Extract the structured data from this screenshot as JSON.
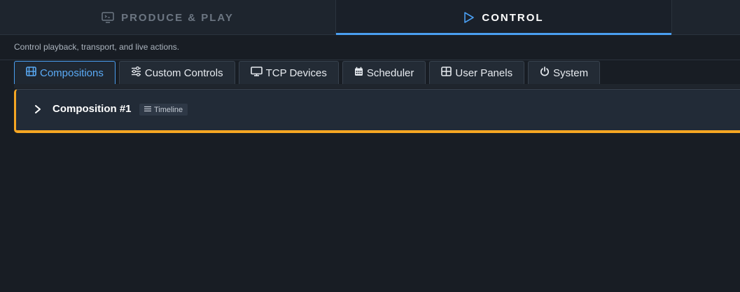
{
  "top_nav": {
    "produce_label": "PRODUCE & PLAY",
    "control_label": "CONTROL",
    "produce_icon": "monitor-code-icon",
    "control_icon": "play-triangle-icon",
    "active": "CONTROL"
  },
  "subtitle": "Control playback, transport, and live actions.",
  "tabs": [
    {
      "label": "Compositions",
      "icon": "film-icon",
      "active": true
    },
    {
      "label": "Custom Controls",
      "icon": "sliders-icon",
      "active": false
    },
    {
      "label": "TCP Devices",
      "icon": "monitor-icon",
      "active": false
    },
    {
      "label": "Scheduler",
      "icon": "calendar-icon",
      "active": false
    },
    {
      "label": "User Panels",
      "icon": "grid-icon",
      "active": false
    },
    {
      "label": "System",
      "icon": "power-icon",
      "active": false
    }
  ],
  "composition": {
    "name": "Composition #1",
    "badge": "Timeline",
    "badge_icon": "list-icon",
    "expand_icon": "chevron-right-icon"
  },
  "colors": {
    "background": "#181d24",
    "accent_blue": "#4a9ef0",
    "accent_orange": "#f5a623"
  }
}
